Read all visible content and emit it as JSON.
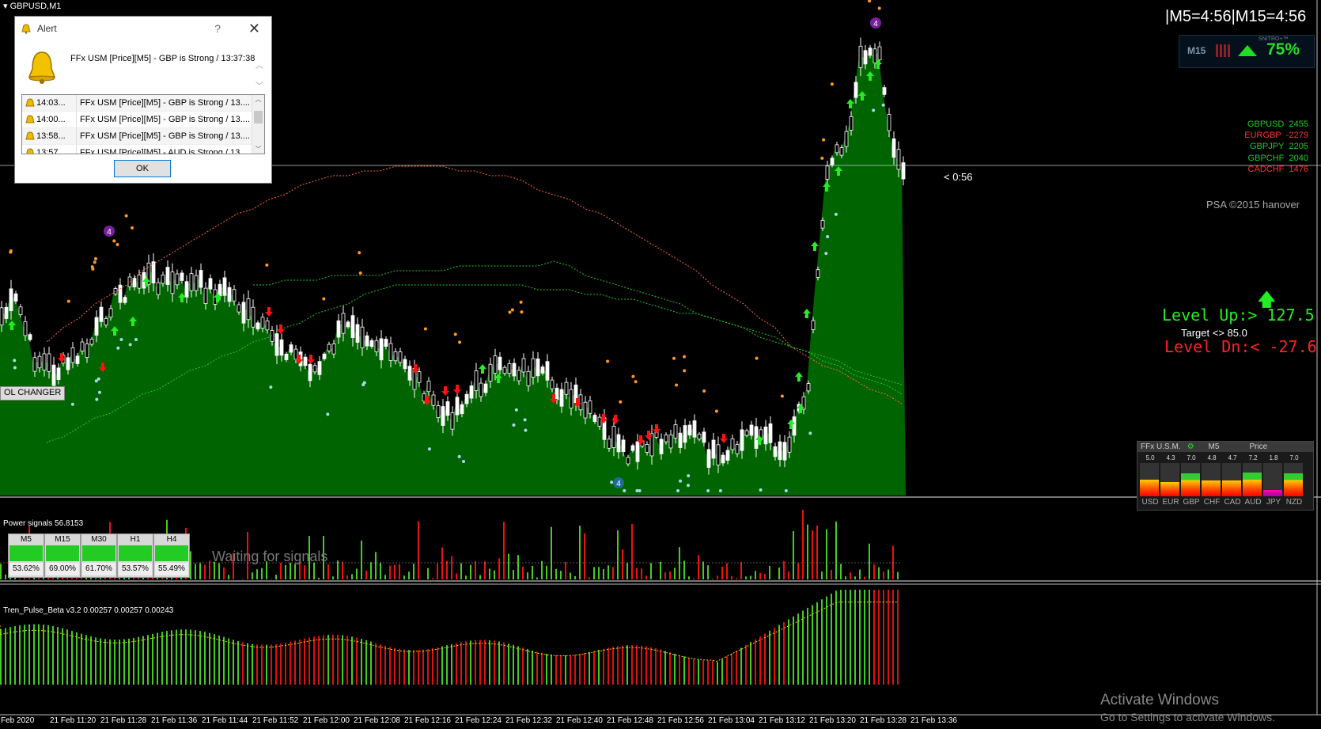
{
  "chart": {
    "title": "GBPUSD,M1",
    "countdown": "< 0:56",
    "level_labels": [
      "4",
      "4",
      "4"
    ]
  },
  "timer": "|M5=4:56|M15=4:56",
  "gauge": {
    "tf": "M15",
    "percent": "75%",
    "tiny": "SNITRO+™"
  },
  "strength": [
    {
      "pair": "GBPUSD",
      "value": "2455",
      "color": "#22cc22"
    },
    {
      "pair": "EURGBP",
      "value": "-2279",
      "color": "#ff3333"
    },
    {
      "pair": "GBPJPY",
      "value": "2205",
      "color": "#22cc22"
    },
    {
      "pair": "GBPCHF",
      "value": "2040",
      "color": "#22cc22"
    },
    {
      "pair": "CADCHF",
      "value": "1476",
      "color": "#ff3333"
    }
  ],
  "psa": "PSA ©2015 hanover",
  "levels": {
    "up": "Level Up:>  127.5",
    "target": "Target <> 85.0",
    "down": "Level Dn:<  -27.6"
  },
  "changer_label": "OL CHANGER",
  "ffx_panel": {
    "title": "FFx U.S.M.",
    "tf": "M5",
    "mode": "Price",
    "values": [
      "5.0",
      "4.3",
      "7.0",
      "4.8",
      "4.7",
      "7.2",
      "1.8",
      "7.0"
    ],
    "currencies": [
      "USD",
      "EUR",
      "GBP",
      "CHF",
      "CAD",
      "AUD",
      "JPY",
      "NZD"
    ],
    "bar_levels": [
      0.5,
      0.43,
      0.7,
      0.48,
      0.47,
      0.72,
      0.18,
      0.7
    ]
  },
  "power_signals": {
    "label": "Power signals 56.8153",
    "waiting": "Waiting for signals",
    "boxes": [
      {
        "tf": "M5",
        "pct": "53.62%"
      },
      {
        "tf": "M15",
        "pct": "69.00%"
      },
      {
        "tf": "M30",
        "pct": "61.70%"
      },
      {
        "tf": "H1",
        "pct": "53.57%"
      },
      {
        "tf": "H4",
        "pct": "55.49%"
      }
    ]
  },
  "tren_pulse": {
    "label": "Tren_Pulse_Beta v3.2 0.00257 0.00257 0.00243"
  },
  "x_axis": [
    "Feb 2020",
    "21 Feb 11:20",
    "21 Feb 11:28",
    "21 Feb 11:36",
    "21 Feb 11:44",
    "21 Feb 11:52",
    "21 Feb 12:00",
    "21 Feb 12:08",
    "21 Feb 12:16",
    "21 Feb 12:24",
    "21 Feb 12:32",
    "21 Feb 12:40",
    "21 Feb 12:48",
    "21 Feb 12:56",
    "21 Feb 13:04",
    "21 Feb 13:12",
    "21 Feb 13:20",
    "21 Feb 13:28",
    "21 Feb 13:36"
  ],
  "watermark": {
    "line1": "Activate Windows",
    "line2": "Go to Settings to activate Windows."
  },
  "alert": {
    "title": "Alert",
    "help": "?",
    "close": "✕",
    "message": "FFx USM [Price][M5] - GBP is Strong / 13:37:38",
    "rows": [
      {
        "time": "14:03...",
        "msg": "FFx USM [Price][M5] - GBP is Strong / 13...."
      },
      {
        "time": "14:00...",
        "msg": "FFx USM [Price][M5] - GBP is Strong / 13...."
      },
      {
        "time": "13:58...",
        "msg": "FFx USM [Price][M5] - GBP is Strong / 13...."
      },
      {
        "time": "13:57...",
        "msg": "FFx USM [Price][M5] - AUD is Strong / 13...."
      }
    ],
    "ok": "OK"
  },
  "colors": {
    "up": "#22cc22",
    "down": "#ff2222",
    "area": "#006400",
    "candle_up": "#ffffff"
  }
}
